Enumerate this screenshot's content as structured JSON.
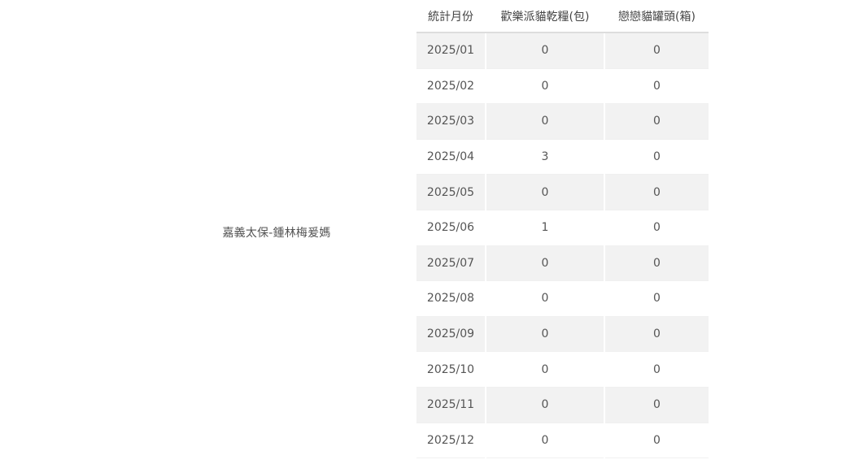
{
  "owner": {
    "name": "嘉義太保-鍾林梅爰媽"
  },
  "table": {
    "headers": [
      "統計月份",
      "歡樂派貓乾糧(包)",
      "戀戀貓罐頭(箱)"
    ],
    "rows": [
      {
        "month": "2025/01",
        "dry_food": "0",
        "canned": "0"
      },
      {
        "month": "2025/02",
        "dry_food": "0",
        "canned": "0"
      },
      {
        "month": "2025/03",
        "dry_food": "0",
        "canned": "0"
      },
      {
        "month": "2025/04",
        "dry_food": "3",
        "canned": "0"
      },
      {
        "month": "2025/05",
        "dry_food": "0",
        "canned": "0"
      },
      {
        "month": "2025/06",
        "dry_food": "1",
        "canned": "0"
      },
      {
        "month": "2025/07",
        "dry_food": "0",
        "canned": "0"
      },
      {
        "month": "2025/08",
        "dry_food": "0",
        "canned": "0"
      },
      {
        "month": "2025/09",
        "dry_food": "0",
        "canned": "0"
      },
      {
        "month": "2025/10",
        "dry_food": "0",
        "canned": "0"
      },
      {
        "month": "2025/11",
        "dry_food": "0",
        "canned": "0"
      },
      {
        "month": "2025/12",
        "dry_food": "0",
        "canned": "0"
      }
    ]
  }
}
